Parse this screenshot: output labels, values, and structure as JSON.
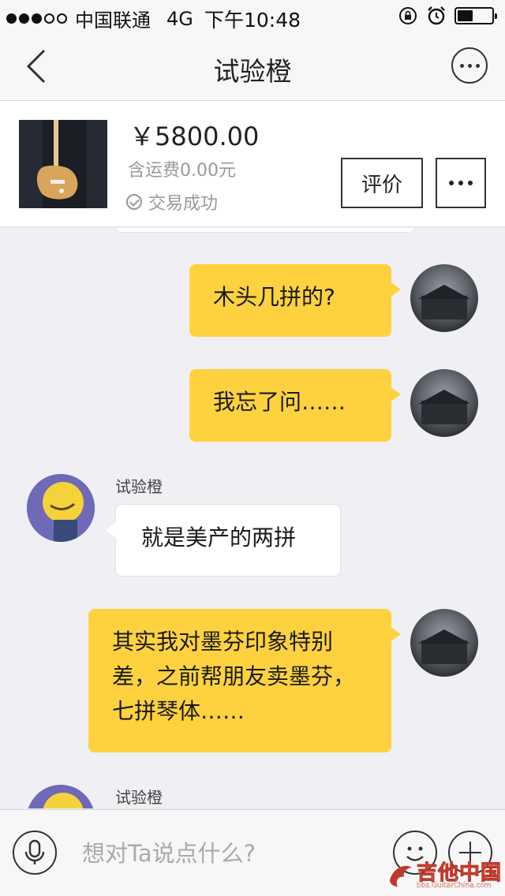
{
  "status_bar": {
    "carrier": "中国联通",
    "network": "4G",
    "time": "下午10:48",
    "signal_bars_filled": 3,
    "signal_bars_total": 5,
    "battery_level": 0.45
  },
  "nav": {
    "title": "试验橙",
    "back_icon": "chevron-left-icon",
    "more_icon": "ellipsis-circle-icon"
  },
  "product": {
    "price": "￥5800.00",
    "shipping": "含运费0.00元",
    "trade_status": "交易成功",
    "rate_button": "评价",
    "more_button_icon": "ellipsis-icon"
  },
  "messages": [
    {
      "from": "me",
      "text": "木头几拼的?"
    },
    {
      "from": "me",
      "text": "我忘了问……"
    },
    {
      "from": "other",
      "sender": "试验橙",
      "text": "就是美产的两拼"
    },
    {
      "from": "me",
      "text": "其实我对墨芬印象特别差，之前帮朋友卖墨芬，七拼琴体……"
    },
    {
      "from": "other",
      "sender": "试验橙",
      "text": ""
    }
  ],
  "input": {
    "placeholder": "想对Ta说点什么?",
    "mic_icon": "microphone-icon",
    "emoji_icon": "smiley-icon",
    "add_icon": "plus-circle-icon"
  },
  "watermark": {
    "title": "吉他中国",
    "url": "bbs.GuitarChina.com"
  },
  "colors": {
    "my_bubble": "#fed23e",
    "chat_background": "#efeff4"
  }
}
